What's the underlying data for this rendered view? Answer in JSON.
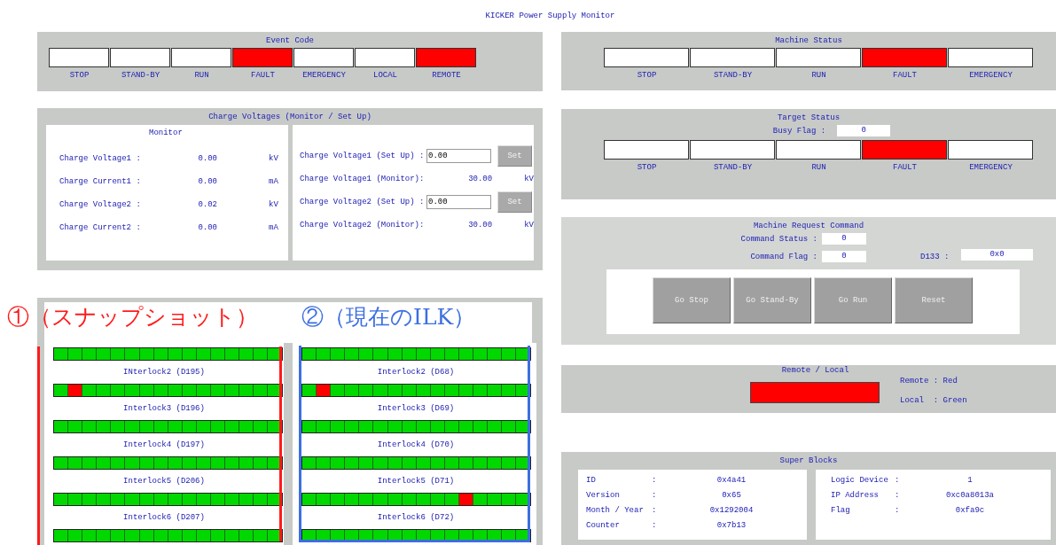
{
  "title": "KICKER Power Supply Monitor",
  "event_code": {
    "title": "Event Code",
    "indicators": [
      {
        "label": "STOP",
        "on": false
      },
      {
        "label": "STAND-BY",
        "on": false
      },
      {
        "label": "RUN",
        "on": false
      },
      {
        "label": "FAULT",
        "on": true
      },
      {
        "label": "EMERGENCY",
        "on": false
      },
      {
        "label": "LOCAL",
        "on": false
      },
      {
        "label": "REMOTE",
        "on": true
      }
    ]
  },
  "charge": {
    "title": "Charge Voltages (Monitor / Set Up)",
    "monitor_title": "Monitor",
    "monitor_rows": [
      {
        "label": "Charge Voltage1 :",
        "value": "0.00",
        "unit": "kV"
      },
      {
        "label": "Charge Current1 :",
        "value": "0.00",
        "unit": "mA"
      },
      {
        "label": "Charge Voltage2 :",
        "value": "0.02",
        "unit": "kV"
      },
      {
        "label": "Charge Current2 :",
        "value": "0.00",
        "unit": "mA"
      }
    ],
    "setup_rows": [
      {
        "kind": "setup",
        "label": "Charge Voltage1 (Set Up) :",
        "value": "0.00",
        "button": "Set"
      },
      {
        "kind": "monitor",
        "label": "Charge Voltage1 (Monitor):",
        "value": "30.00",
        "unit": "kV"
      },
      {
        "kind": "setup",
        "label": "Charge Voltage2 (Set Up) :",
        "value": "0.00",
        "button": "Set"
      },
      {
        "kind": "monitor",
        "label": "Charge Voltage2 (Monitor):",
        "value": "30.00",
        "unit": "kV"
      }
    ]
  },
  "annotations": [
    {
      "text": "①（スナップショット）",
      "color": "#ff1a1a"
    },
    {
      "text": "②（現在のILK）",
      "color": "#3c6fe0"
    }
  ],
  "interlocks": [
    {
      "bars": [
        {
          "cells": [
            false,
            false,
            false,
            false,
            false,
            false,
            false,
            false,
            false,
            false,
            false,
            false,
            false,
            false,
            false,
            false
          ]
        },
        {
          "label": "INterlock2 (D195)",
          "cells": [
            false,
            true,
            false,
            false,
            false,
            false,
            false,
            false,
            false,
            false,
            false,
            false,
            false,
            false,
            false,
            false
          ]
        },
        {
          "label": "Interlock3 (D196)",
          "cells": [
            false,
            false,
            false,
            false,
            false,
            false,
            false,
            false,
            false,
            false,
            false,
            false,
            false,
            false,
            false,
            false
          ]
        },
        {
          "label": "Interlock4 (D197)",
          "cells": [
            false,
            false,
            false,
            false,
            false,
            false,
            false,
            false,
            false,
            false,
            false,
            false,
            false,
            false,
            false,
            false
          ]
        },
        {
          "label": "Interlock5 (D206)",
          "cells": [
            false,
            false,
            false,
            false,
            false,
            false,
            false,
            false,
            false,
            false,
            false,
            false,
            false,
            false,
            false,
            false
          ]
        },
        {
          "label": "Interlock6 (D207)",
          "cells": [
            false,
            false,
            false,
            false,
            false,
            false,
            false,
            false,
            false,
            false,
            false,
            false,
            false,
            false,
            false,
            false
          ]
        }
      ]
    },
    {
      "bars": [
        {
          "cells": [
            false,
            false,
            false,
            false,
            false,
            false,
            false,
            false,
            false,
            false,
            false,
            false,
            false,
            false,
            false,
            false
          ]
        },
        {
          "label": "Interlock2 (D68)",
          "cells": [
            false,
            true,
            false,
            false,
            false,
            false,
            false,
            false,
            false,
            false,
            false,
            false,
            false,
            false,
            false,
            false
          ]
        },
        {
          "label": "Interlock3 (D69)",
          "cells": [
            false,
            false,
            false,
            false,
            false,
            false,
            false,
            false,
            false,
            false,
            false,
            false,
            false,
            false,
            false,
            false
          ]
        },
        {
          "label": "Interlock4 (D70)",
          "cells": [
            false,
            false,
            false,
            false,
            false,
            false,
            false,
            false,
            false,
            false,
            false,
            false,
            false,
            false,
            false,
            false
          ]
        },
        {
          "label": "Interlock5 (D71)",
          "cells": [
            false,
            false,
            false,
            false,
            false,
            false,
            false,
            false,
            false,
            false,
            false,
            true,
            false,
            false,
            false,
            false
          ]
        },
        {
          "label": "Interlock6 (D72)",
          "cells": [
            false,
            false,
            false,
            false,
            false,
            false,
            false,
            false,
            false,
            false,
            false,
            false,
            false,
            false,
            false,
            false
          ]
        }
      ]
    }
  ],
  "machine_status": {
    "title": "Machine Status",
    "indicators": [
      {
        "label": "STOP",
        "on": false
      },
      {
        "label": "STAND-BY",
        "on": false
      },
      {
        "label": "RUN",
        "on": false
      },
      {
        "label": "FAULT",
        "on": true
      },
      {
        "label": "EMERGENCY",
        "on": false
      }
    ]
  },
  "target_status": {
    "title": "Target Status",
    "busy_label": "Busy Flag :",
    "busy_value": "0",
    "indicators": [
      {
        "label": "STOP",
        "on": false
      },
      {
        "label": "STAND-BY",
        "on": false
      },
      {
        "label": "RUN",
        "on": false
      },
      {
        "label": "FAULT",
        "on": true
      },
      {
        "label": "EMERGENCY",
        "on": false
      }
    ]
  },
  "request": {
    "title": "Machine Request Command",
    "status_label": "Command Status :",
    "status_value": "0",
    "flag_label": "Command Flag :",
    "flag_value": "0",
    "d_label": "D133 :",
    "d_value": "0x0",
    "buttons": [
      "Go Stop",
      "Go Stand-By",
      "Go Run",
      "Reset"
    ]
  },
  "remote_local": {
    "title": "Remote / Local",
    "remote": true,
    "legend": [
      "Remote : Red",
      "Local  : Green"
    ]
  },
  "super_blocks": {
    "title": "Super Blocks",
    "groups": [
      [
        {
          "label": "ID",
          "sep": ":",
          "value": "0x4a41"
        },
        {
          "label": "Version",
          "sep": ":",
          "value": "0x65"
        },
        {
          "label": "Month / Year",
          "sep": ":",
          "value": "0x1292004"
        },
        {
          "label": "Counter",
          "sep": ":",
          "value": "0x7b13"
        }
      ],
      [
        {
          "label": "Logic Device",
          "sep": ":",
          "value": "1"
        },
        {
          "label": "IP Address",
          "sep": ":",
          "value": "0xc0a8013a"
        },
        {
          "label": "Flag",
          "sep": ":",
          "value": "0xfa9c"
        }
      ]
    ]
  }
}
